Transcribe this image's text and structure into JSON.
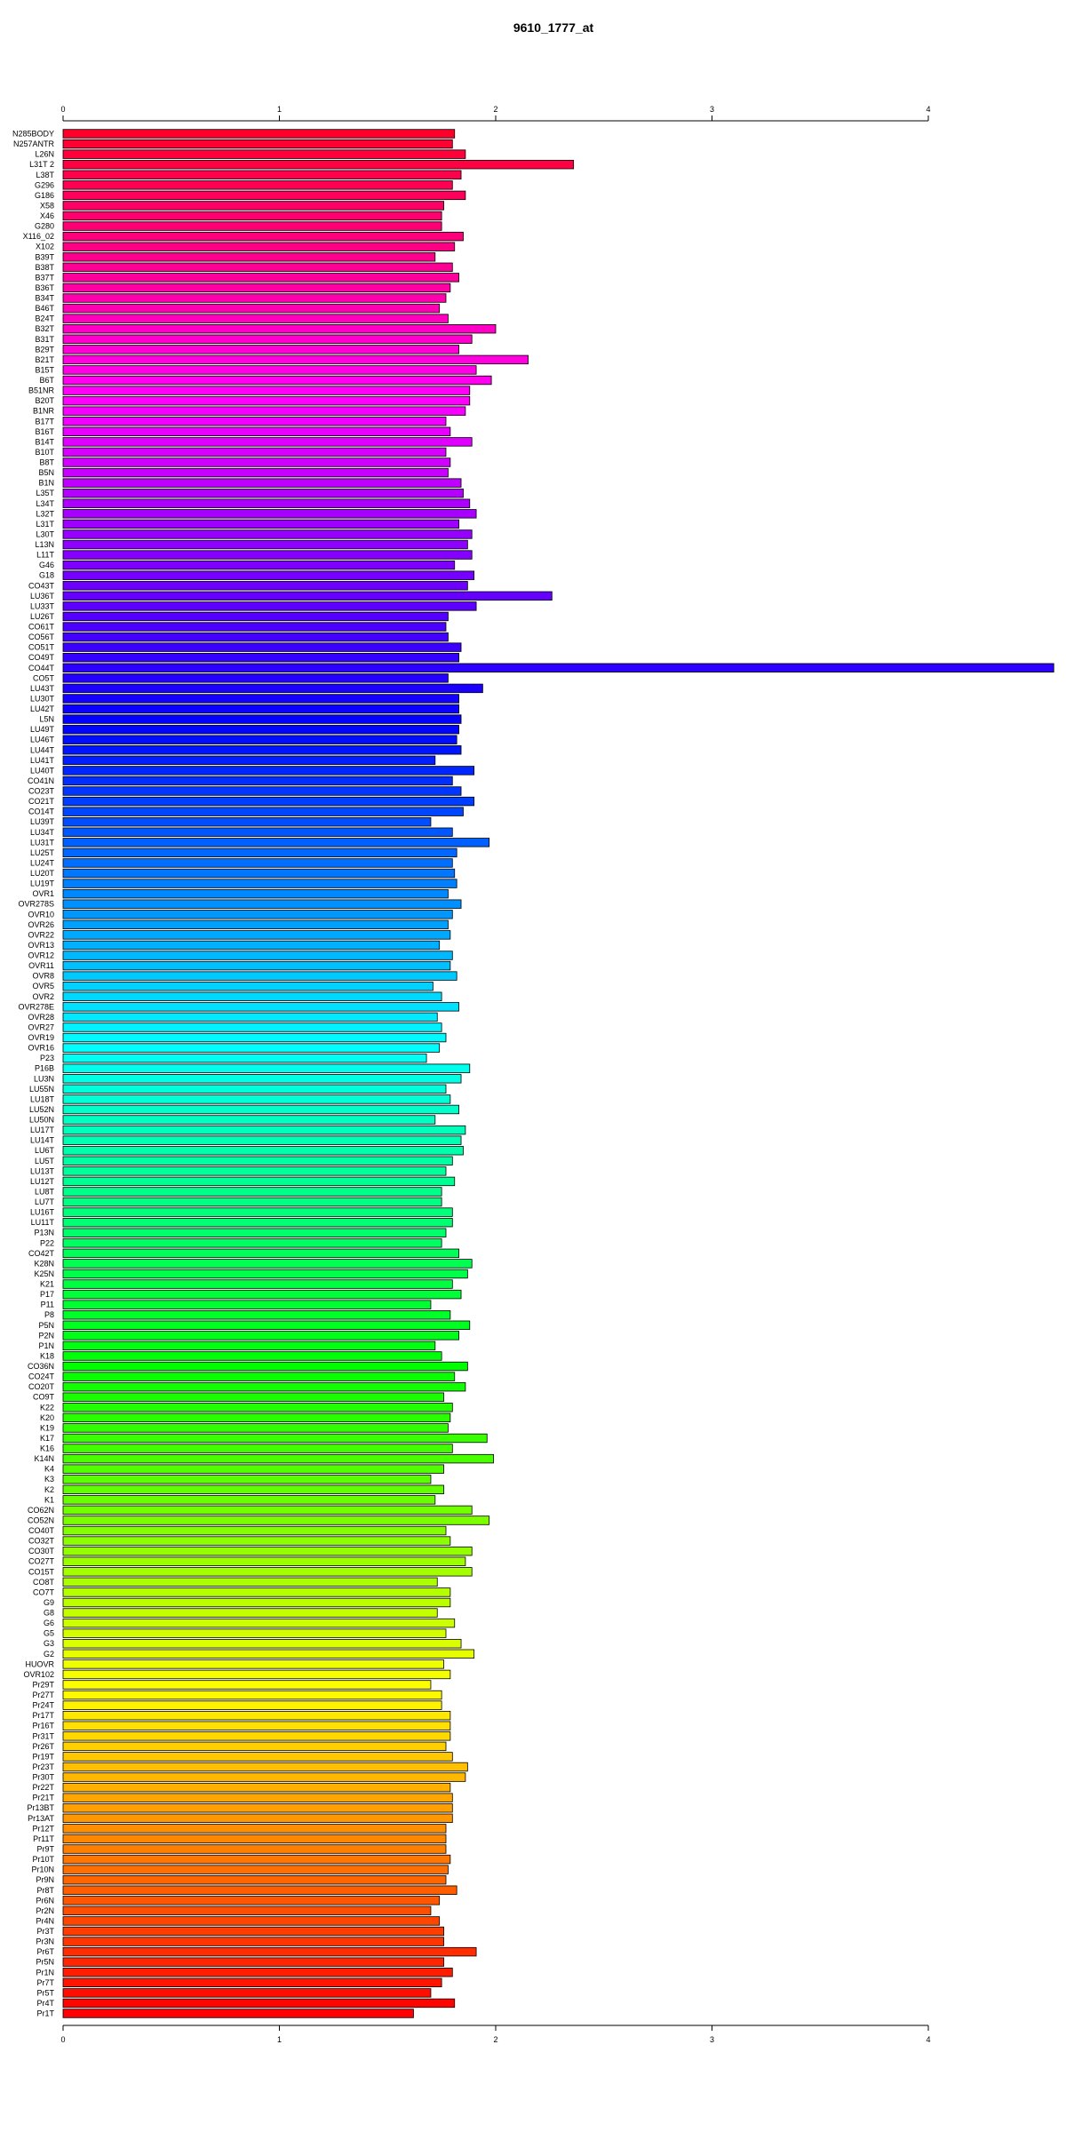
{
  "chart_data": {
    "type": "bar",
    "orientation": "horizontal",
    "title": "9610_1777_at",
    "xlim": [
      0,
      4
    ],
    "xticks": [
      0,
      1,
      2,
      3,
      4
    ],
    "grid": false,
    "legend": "none",
    "categories": [
      "N285BODY",
      "N257ANTR",
      "L26N",
      "L31T 2",
      "L38T",
      "G296",
      "G186",
      "X58",
      "X46",
      "G280",
      "X116_02",
      "X102",
      "B39T",
      "B38T",
      "B37T",
      "B36T",
      "B34T",
      "B46T",
      "B24T",
      "B32T",
      "B31T",
      "B29T",
      "B21T",
      "B15T",
      "B6T",
      "B51NR",
      "B20T",
      "B1NR",
      "B17T",
      "B16T",
      "B14T",
      "B10T",
      "B8T",
      "B5N",
      "B1N",
      "L35T",
      "L34T",
      "L32T",
      "L31T",
      "L30T",
      "L13N",
      "L11T",
      "G46",
      "G18",
      "CO43T",
      "LU36T",
      "LU33T",
      "LU26T",
      "CO61T",
      "CO56T",
      "CO51T",
      "CO49T",
      "CO44T",
      "CO5T",
      "LU43T",
      "LU30T",
      "LU42T",
      "L5N",
      "LU49T",
      "LU46T",
      "LU44T",
      "LU41T",
      "LU40T",
      "CO41N",
      "CO23T",
      "CO21T",
      "CO14T",
      "LU39T",
      "LU34T",
      "LU31T",
      "LU25T",
      "LU24T",
      "LU20T",
      "LU19T",
      "OVR1",
      "OVR278S",
      "OVR10",
      "OVR26",
      "OVR22",
      "OVR13",
      "OVR12",
      "OVR11",
      "OVR8",
      "OVR5",
      "OVR2",
      "OVR278E",
      "OVR28",
      "OVR27",
      "OVR19",
      "OVR16",
      "P23",
      "P16B",
      "LU3N",
      "LU55N",
      "LU18T",
      "LU52N",
      "LU50N",
      "LU17T",
      "LU14T",
      "LU6T",
      "LU5T",
      "LU13T",
      "LU12T",
      "LU8T",
      "LU7T",
      "LU16T",
      "LU11T",
      "P13N",
      "P22",
      "CO42T",
      "K28N",
      "K25N",
      "K21",
      "P17",
      "P11",
      "P8",
      "P5N",
      "P2N",
      "P1N",
      "K18",
      "CO36N",
      "CO24T",
      "CO20T",
      "CO9T",
      "K22",
      "K20",
      "K19",
      "K17",
      "K16",
      "K14N",
      "K4",
      "K3",
      "K2",
      "K1",
      "CO62N",
      "CO52N",
      "CO40T",
      "CO32T",
      "CO30T",
      "CO27T",
      "CO15T",
      "CO8T",
      "CO7T",
      "G9",
      "G8",
      "G6",
      "G5",
      "G3",
      "G2",
      "HUOVR",
      "OVR102",
      "Pr29T",
      "Pr27T",
      "Pr24T",
      "Pr17T",
      "Pr16T",
      "Pr31T",
      "Pr26T",
      "Pr19T",
      "Pr23T",
      "Pr30T",
      "Pr22T",
      "Pr21T",
      "Pr13BT",
      "Pr13AT",
      "Pr12T",
      "Pr11T",
      "Pr9T",
      "Pr10T",
      "Pr10N",
      "Pr9N",
      "Pr8T",
      "Pr6N",
      "Pr2N",
      "Pr4N",
      "Pr3T",
      "Pr3N",
      "Pr6T",
      "Pr5N",
      "Pr1N",
      "Pr7T",
      "Pr5T",
      "Pr4T",
      "Pr1T"
    ],
    "values": [
      1.81,
      1.8,
      1.86,
      2.36,
      1.84,
      1.8,
      1.86,
      1.76,
      1.75,
      1.75,
      1.85,
      1.81,
      1.72,
      1.8,
      1.83,
      1.79,
      1.77,
      1.74,
      1.78,
      2.0,
      1.89,
      1.83,
      2.15,
      1.91,
      1.98,
      1.88,
      1.88,
      1.86,
      1.77,
      1.79,
      1.89,
      1.77,
      1.79,
      1.78,
      1.84,
      1.85,
      1.88,
      1.91,
      1.83,
      1.89,
      1.87,
      1.89,
      1.81,
      1.9,
      1.87,
      2.26,
      1.91,
      1.78,
      1.77,
      1.78,
      1.84,
      1.83,
      4.58,
      1.78,
      1.94,
      1.83,
      1.83,
      1.84,
      1.83,
      1.82,
      1.84,
      1.72,
      1.9,
      1.8,
      1.84,
      1.9,
      1.85,
      1.7,
      1.8,
      1.97,
      1.82,
      1.8,
      1.81,
      1.82,
      1.78,
      1.84,
      1.8,
      1.78,
      1.79,
      1.74,
      1.8,
      1.79,
      1.82,
      1.71,
      1.75,
      1.83,
      1.73,
      1.75,
      1.77,
      1.74,
      1.68,
      1.88,
      1.84,
      1.77,
      1.79,
      1.83,
      1.72,
      1.86,
      1.84,
      1.85,
      1.8,
      1.77,
      1.81,
      1.75,
      1.75,
      1.8,
      1.8,
      1.77,
      1.75,
      1.83,
      1.89,
      1.87,
      1.8,
      1.84,
      1.7,
      1.79,
      1.88,
      1.83,
      1.72,
      1.75,
      1.87,
      1.81,
      1.86,
      1.76,
      1.8,
      1.79,
      1.78,
      1.96,
      1.8,
      1.99,
      1.76,
      1.7,
      1.76,
      1.72,
      1.89,
      1.97,
      1.77,
      1.79,
      1.89,
      1.86,
      1.89,
      1.73,
      1.79,
      1.79,
      1.73,
      1.81,
      1.77,
      1.84,
      1.9,
      1.76,
      1.79,
      1.7,
      1.75,
      1.75,
      1.79,
      1.79,
      1.79,
      1.77,
      1.8,
      1.87,
      1.86,
      1.79,
      1.8,
      1.8,
      1.8,
      1.77,
      1.77,
      1.77,
      1.79,
      1.78,
      1.77,
      1.82,
      1.74,
      1.7,
      1.74,
      1.76,
      1.76,
      1.91,
      1.76,
      1.8,
      1.75,
      1.7,
      1.81,
      1.62
    ]
  }
}
